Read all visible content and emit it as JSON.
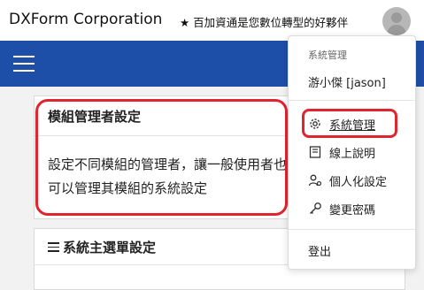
{
  "header": {
    "brand": "DXForm Corporation",
    "slogan": "★ 百加資通是您數位轉型的好夥伴"
  },
  "cards": [
    {
      "title": "模組管理者設定",
      "description": "設定不同模組的管理者，讓一般使用者也可以管理其模組的系統設定"
    },
    {
      "title": "系統主選單設定"
    }
  ],
  "dropdown": {
    "header": "系統管理",
    "user": "游小傑 [jason]",
    "items": [
      {
        "label": "系統管理",
        "icon": "gear-icon"
      },
      {
        "label": "線上說明",
        "icon": "book-icon"
      },
      {
        "label": "個人化設定",
        "icon": "user-settings-icon"
      },
      {
        "label": "變更密碼",
        "icon": "key-icon"
      }
    ],
    "logout": "登出"
  },
  "colors": {
    "navbar": "#1d4fa8",
    "highlight": "#e0252f"
  }
}
